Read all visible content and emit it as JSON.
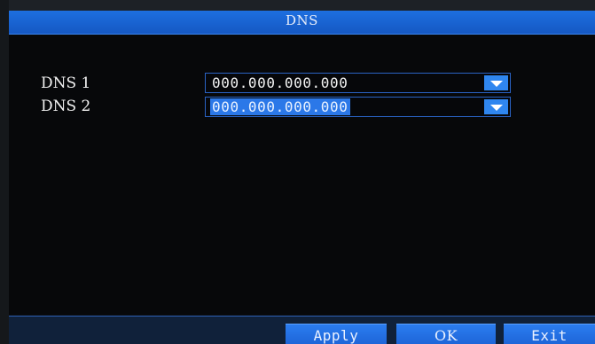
{
  "window": {
    "title": "DNS"
  },
  "fields": [
    {
      "label": "DNS 1",
      "value": "000.000.000.000",
      "selected": false,
      "dropdown_icon": "chevron-down-icon"
    },
    {
      "label": "DNS 2",
      "value": "000.000.000.000",
      "selected": true,
      "dropdown_icon": "chevron-down-icon"
    }
  ],
  "buttons": {
    "apply_label": "Apply",
    "ok_label": "OK",
    "exit_label": "Exit"
  },
  "colors": {
    "accent": "#1d6fe0",
    "selection": "#2b78e8",
    "background": "#07080a"
  }
}
